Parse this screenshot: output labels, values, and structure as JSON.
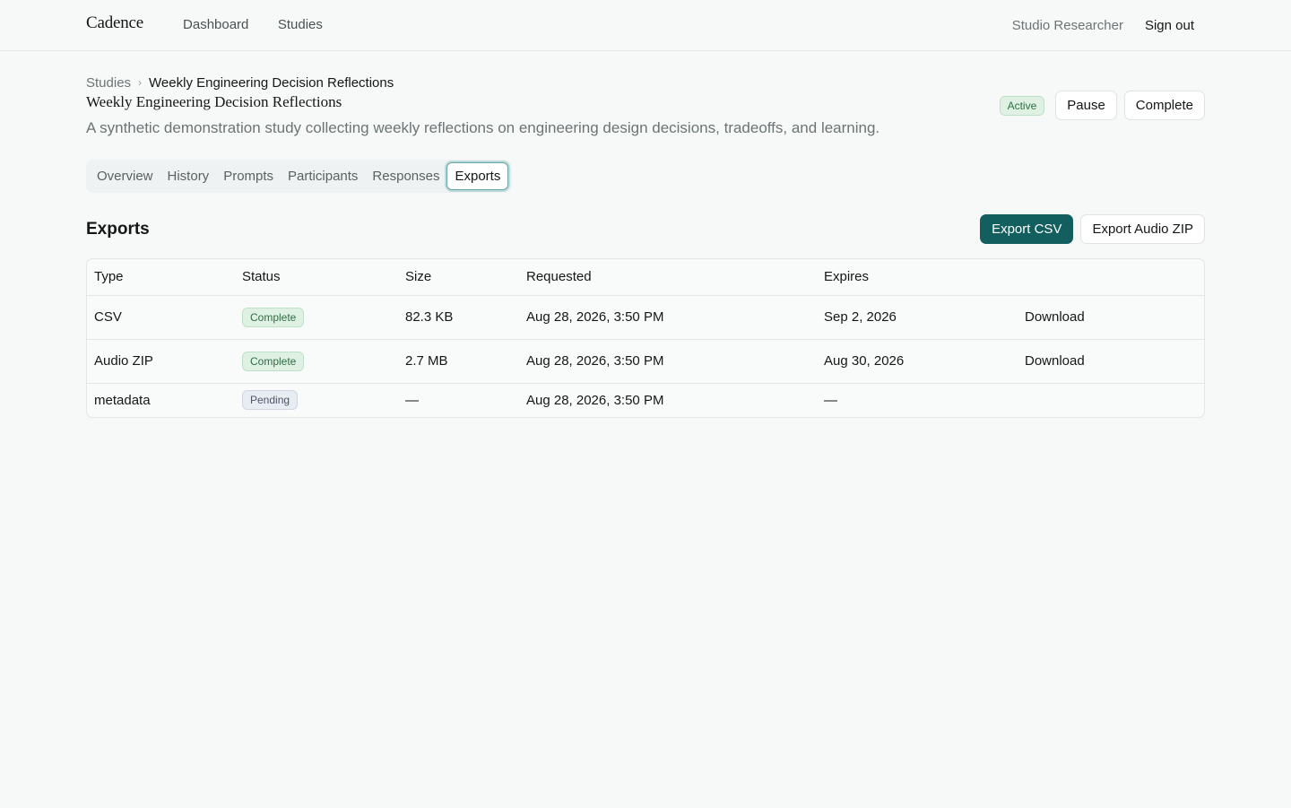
{
  "header": {
    "brand": "Cadence",
    "nav": [
      "Dashboard",
      "Studies"
    ],
    "user": "Studio Researcher",
    "signout": "Sign out"
  },
  "breadcrumb": {
    "root": "Studies",
    "current": "Weekly Engineering Decision Reflections"
  },
  "study": {
    "title": "Weekly Engineering Decision Reflections",
    "description": "A synthetic demonstration study collecting weekly reflections on engineering design decisions, tradeoffs, and learning.",
    "status": "Active",
    "pause_label": "Pause",
    "complete_label": "Complete"
  },
  "tabs": [
    "Overview",
    "History",
    "Prompts",
    "Participants",
    "Responses",
    "Exports"
  ],
  "exports": {
    "title": "Exports",
    "export_csv_label": "Export CSV",
    "export_audio_label": "Export Audio ZIP",
    "columns": [
      "Type",
      "Status",
      "Size",
      "Requested",
      "Expires",
      ""
    ],
    "rows": [
      {
        "type": "CSV",
        "status": "Complete",
        "size": "82.3 KB",
        "requested": "Aug 28, 2026, 3:50 PM",
        "expires": "Sep 2, 2026",
        "action": "Download"
      },
      {
        "type": "Audio ZIP",
        "status": "Complete",
        "size": "2.7 MB",
        "requested": "Aug 28, 2026, 3:50 PM",
        "expires": "Aug 30, 2026",
        "action": "Download"
      },
      {
        "type": "metadata",
        "status": "Pending",
        "size": "—",
        "requested": "Aug 28, 2026, 3:50 PM",
        "expires": "—",
        "action": ""
      }
    ]
  },
  "colors": {
    "accent": "#135e5e",
    "complete_bg": "#dff1e3",
    "pending_bg": "#e8ecf3",
    "page_bg": "#f7f9f9"
  }
}
